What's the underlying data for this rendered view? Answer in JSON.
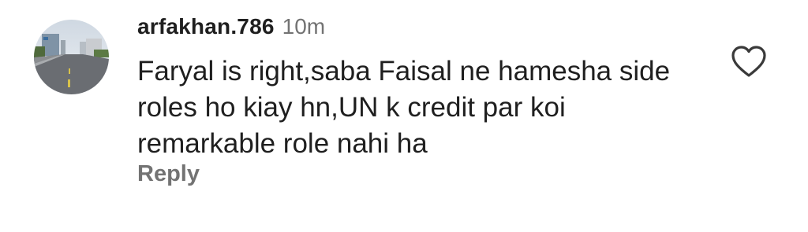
{
  "comment": {
    "username": "arfakhan.786",
    "timestamp": "10m",
    "text": "Faryal is right,saba Faisal ne hamesha side roles ho kiay hn,UN k credit par koi remarkable role nahi ha",
    "reply_label": "Reply",
    "like_icon": "heart-outline-icon",
    "avatar": "road-scene-avatar"
  },
  "colors": {
    "text_primary": "#1f1f1f",
    "text_secondary": "#737373",
    "background": "#ffffff"
  }
}
